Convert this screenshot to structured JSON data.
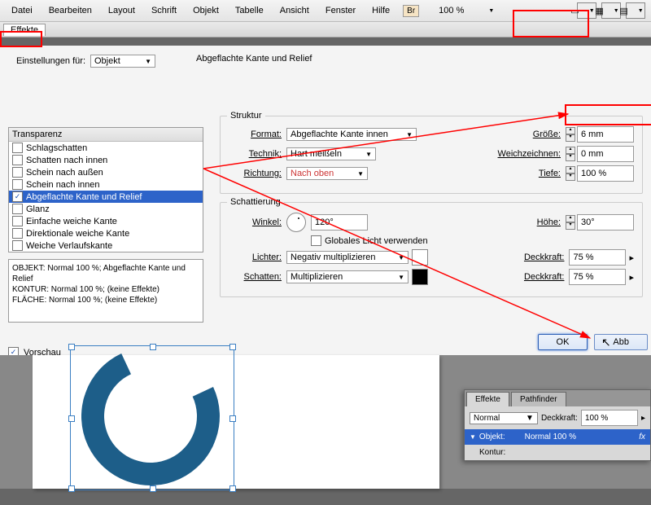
{
  "menu": {
    "items": [
      "Datei",
      "Bearbeiten",
      "Layout",
      "Schrift",
      "Objekt",
      "Tabelle",
      "Ansicht",
      "Fenster",
      "Hilfe"
    ],
    "br": "Br",
    "zoom": "100 %"
  },
  "tab": "Effekte",
  "settings_for": {
    "label": "Einstellungen für:",
    "value": "Objekt"
  },
  "section_title": "Abgeflachte Kante und Relief",
  "list": {
    "header": "Transparenz",
    "items": [
      {
        "label": "Schlagschatten",
        "checked": false
      },
      {
        "label": "Schatten nach innen",
        "checked": false
      },
      {
        "label": "Schein nach außen",
        "checked": false
      },
      {
        "label": "Schein nach innen",
        "checked": false
      },
      {
        "label": "Abgeflachte Kante und Relief",
        "checked": true,
        "selected": true
      },
      {
        "label": "Glanz",
        "checked": false
      },
      {
        "label": "Einfache weiche Kante",
        "checked": false
      },
      {
        "label": "Direktionale weiche Kante",
        "checked": false
      },
      {
        "label": "Weiche Verlaufskante",
        "checked": false
      }
    ]
  },
  "info": {
    "l1": "OBJEKT: Normal 100 %; Abgeflachte Kante und Relief",
    "l2": "KONTUR: Normal 100 %; (keine Effekte)",
    "l3": "FLÄCHE: Normal 100 %; (keine Effekte)"
  },
  "preview": {
    "label": "Vorschau",
    "checked": true
  },
  "struktur": {
    "legend": "Struktur",
    "format": {
      "label": "Format:",
      "value": "Abgeflachte Kante innen"
    },
    "technik": {
      "label": "Technik:",
      "value": "Hart meißeln"
    },
    "richtung": {
      "label": "Richtung:",
      "value": "Nach oben"
    },
    "groesse": {
      "label": "Größe:",
      "value": "6 mm"
    },
    "weich": {
      "label": "Weichzeichnen:",
      "value": "0 mm"
    },
    "tiefe": {
      "label": "Tiefe:",
      "value": "100 %"
    }
  },
  "schatt": {
    "legend": "Schattierung",
    "winkel": {
      "label": "Winkel:",
      "value": "120°"
    },
    "global": {
      "label": "Globales Licht verwenden",
      "checked": false
    },
    "hoehe": {
      "label": "Höhe:",
      "value": "30°"
    },
    "lichter": {
      "label": "Lichter:",
      "value": "Negativ multiplizieren"
    },
    "schatten": {
      "label": "Schatten:",
      "value": "Multiplizieren"
    },
    "deck1": {
      "label": "Deckkraft:",
      "value": "75 %"
    },
    "deck2": {
      "label": "Deckkraft:",
      "value": "75 %"
    }
  },
  "buttons": {
    "ok": "OK",
    "cancel": "Abb"
  },
  "fx": {
    "tab1": "Effekte",
    "tab2": "Pathfinder",
    "mode": "Normal",
    "opacity_label": "Deckkraft:",
    "opacity": "100 %",
    "row1a": "Objekt:",
    "row1b": "Normal 100 %",
    "row2a": "Kontur:"
  }
}
